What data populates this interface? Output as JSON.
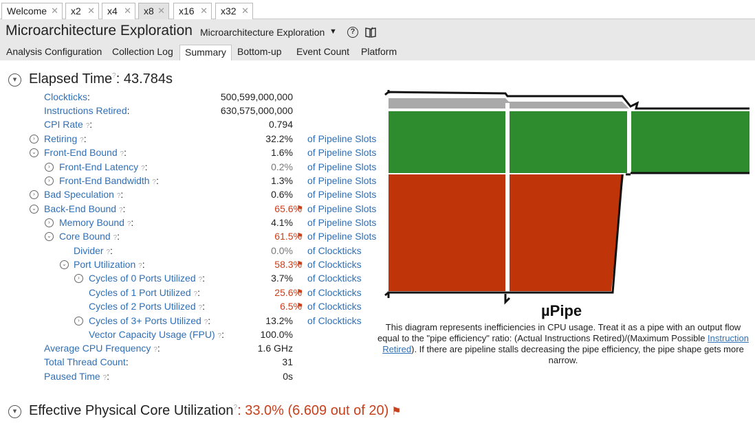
{
  "doc_tabs": [
    {
      "label": "Welcome"
    },
    {
      "label": "x2"
    },
    {
      "label": "x4"
    },
    {
      "label": "x8"
    },
    {
      "label": "x16"
    },
    {
      "label": "x32"
    }
  ],
  "header": {
    "title": "Microarchitecture Exploration",
    "view_selector": "Microarchitecture Exploration"
  },
  "subtabs": [
    {
      "label": "Analysis Configuration"
    },
    {
      "label": "Collection Log"
    },
    {
      "label": "Summary"
    },
    {
      "label": "Bottom-up"
    },
    {
      "label": "Event Count"
    },
    {
      "label": "Platform"
    }
  ],
  "elapsed": {
    "label": "Elapsed Time",
    "value": ": 43.784s"
  },
  "metrics": [
    {
      "label": "Clockticks",
      "value": "500,599,000,000",
      "unit": ""
    },
    {
      "label": "Instructions Retired",
      "value": "630,575,000,000",
      "unit": ""
    },
    {
      "label": "CPI Rate",
      "value": "0.794",
      "unit": ""
    },
    {
      "label": "Retiring",
      "value": "32.2%",
      "unit": "of Pipeline Slots"
    },
    {
      "label": "Front-End Bound",
      "value": "1.6%",
      "unit": "of Pipeline Slots"
    },
    {
      "label": "Front-End Latency",
      "value": "0.2%",
      "unit": "of Pipeline Slots"
    },
    {
      "label": "Front-End Bandwidth",
      "value": "1.3%",
      "unit": "of Pipeline Slots"
    },
    {
      "label": "Bad Speculation",
      "value": "0.6%",
      "unit": "of Pipeline Slots"
    },
    {
      "label": "Back-End Bound",
      "value": "65.6%",
      "unit": "of Pipeline Slots"
    },
    {
      "label": "Memory Bound",
      "value": "4.1%",
      "unit": "of Pipeline Slots"
    },
    {
      "label": "Core Bound",
      "value": "61.5%",
      "unit": "of Pipeline Slots"
    },
    {
      "label": "Divider",
      "value": "0.0%",
      "unit": "of Clockticks"
    },
    {
      "label": "Port Utilization",
      "value": "58.3%",
      "unit": "of Clockticks"
    },
    {
      "label": "Cycles of 0 Ports Utilized",
      "value": "3.7%",
      "unit": "of Clockticks"
    },
    {
      "label": "Cycles of 1 Port Utilized",
      "value": "25.6%",
      "unit": "of Clockticks"
    },
    {
      "label": "Cycles of 2 Ports Utilized",
      "value": "6.5%",
      "unit": "of Clockticks"
    },
    {
      "label": "Cycles of 3+ Ports Utilized",
      "value": "13.2%",
      "unit": "of Clockticks"
    },
    {
      "label": "Vector Capacity Usage (FPU)",
      "value": "100.0%",
      "unit": ""
    },
    {
      "label": "Average CPU Frequency",
      "value": "1.6 GHz",
      "unit": ""
    },
    {
      "label": "Total Thread Count",
      "value": "31",
      "unit": ""
    },
    {
      "label": "Paused Time",
      "value": "0s",
      "unit": ""
    }
  ],
  "pipe": {
    "title": "µPipe",
    "desc_before": "This diagram represents inefficiencies in CPU usage. Treat it as a pipe with an output flow equal to the \"pipe efficiency\" ratio: (Actual Instructions Retired)/(Maximum Possible ",
    "desc_link": "Instruction Retired",
    "desc_after": "). If there are pipeline stalls decreasing the pipe efficiency, the pipe shape gets more narrow.",
    "colors": {
      "retiring": "#2e8b2e",
      "backend": "#c0340a",
      "gray": "#a9a9a9",
      "outline": "#111111"
    }
  },
  "core_util": {
    "label": "Effective Physical Core Utilization",
    "value": ": 33.0% (6.609 out of 20)"
  }
}
